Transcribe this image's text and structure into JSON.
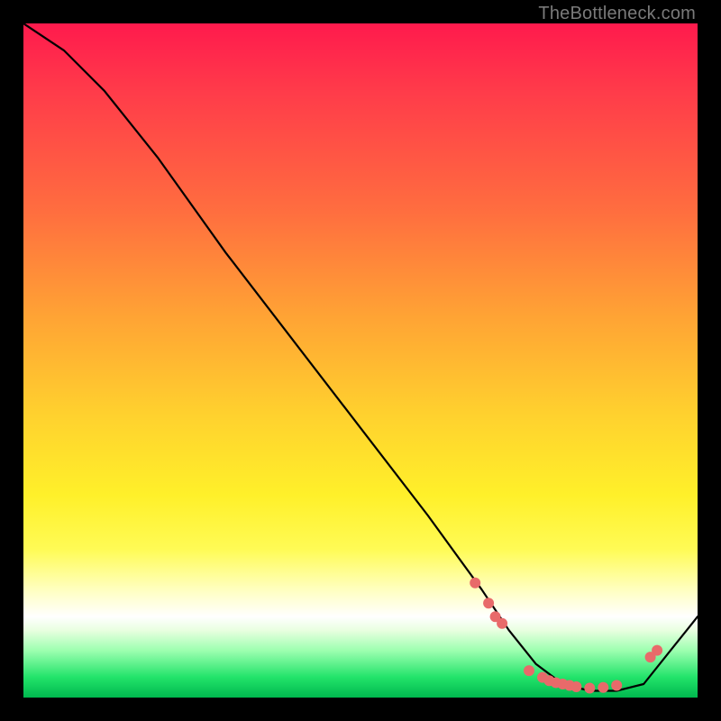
{
  "watermark": "TheBottleneck.com",
  "chart_data": {
    "type": "line",
    "title": "",
    "xlabel": "",
    "ylabel": "",
    "xlim": [
      0,
      100
    ],
    "ylim": [
      0,
      100
    ],
    "curve": {
      "x": [
        0,
        6,
        12,
        20,
        30,
        40,
        50,
        60,
        68,
        72,
        76,
        80,
        84,
        88,
        92,
        96,
        100
      ],
      "y": [
        100,
        96,
        90,
        80,
        66,
        53,
        40,
        27,
        16,
        10,
        5,
        2,
        1,
        1,
        2,
        7,
        12
      ]
    },
    "points": [
      {
        "x": 67,
        "y": 17
      },
      {
        "x": 69,
        "y": 14
      },
      {
        "x": 70,
        "y": 12
      },
      {
        "x": 71,
        "y": 11
      },
      {
        "x": 75,
        "y": 4
      },
      {
        "x": 77,
        "y": 3
      },
      {
        "x": 78,
        "y": 2.5
      },
      {
        "x": 79,
        "y": 2.2
      },
      {
        "x": 80,
        "y": 2
      },
      {
        "x": 81,
        "y": 1.8
      },
      {
        "x": 82,
        "y": 1.6
      },
      {
        "x": 84,
        "y": 1.4
      },
      {
        "x": 86,
        "y": 1.5
      },
      {
        "x": 88,
        "y": 1.8
      },
      {
        "x": 93,
        "y": 6
      },
      {
        "x": 94,
        "y": 7
      }
    ]
  }
}
